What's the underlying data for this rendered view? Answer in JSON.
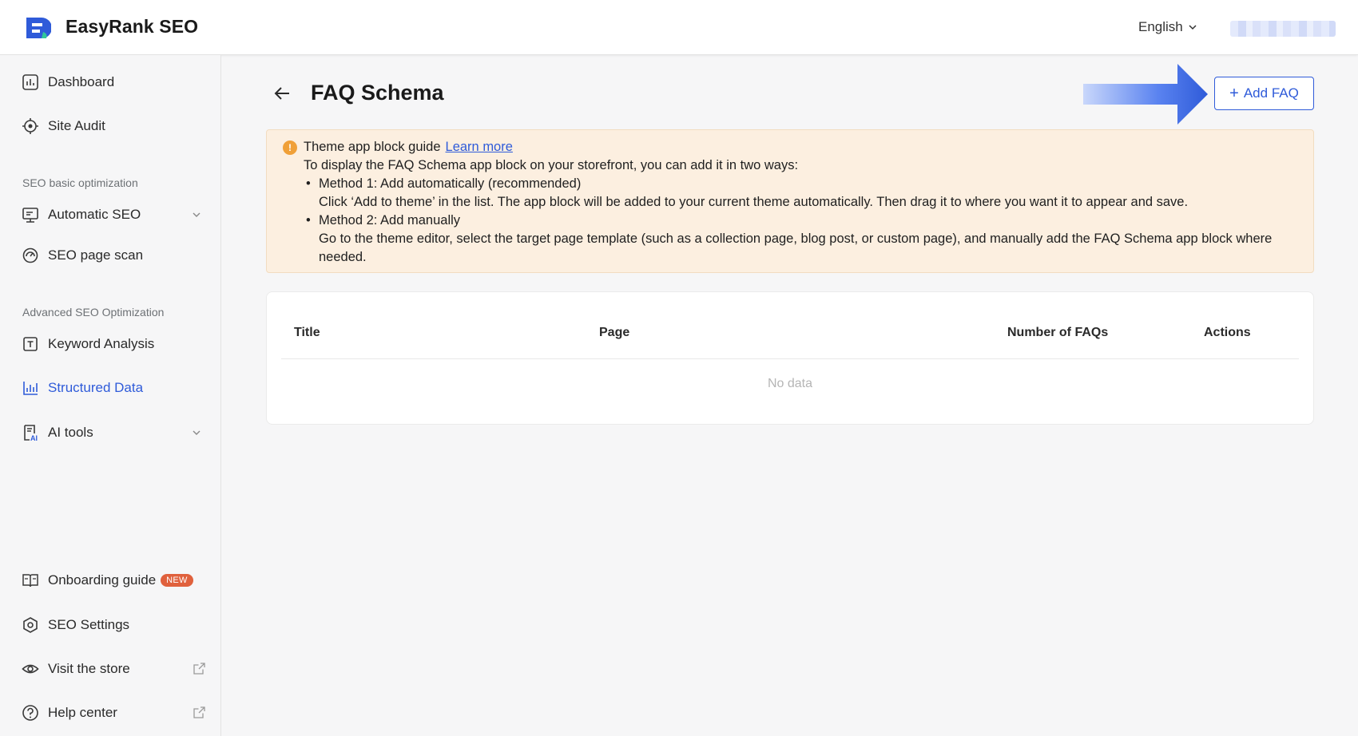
{
  "header": {
    "brand": "EasyRank SEO",
    "language": "English"
  },
  "sidebar": {
    "items_top": [
      {
        "label": "Dashboard",
        "icon": "dashboard-icon"
      },
      {
        "label": "Site Audit",
        "icon": "target-icon"
      }
    ],
    "section_basic": "SEO basic optimization",
    "items_basic": [
      {
        "label": "Automatic SEO",
        "icon": "monitor-icon"
      },
      {
        "label": "SEO page scan",
        "icon": "scan-icon"
      }
    ],
    "section_advanced": "Advanced SEO Optimization",
    "items_advanced": [
      {
        "label": "Keyword Analysis",
        "icon": "keyword-icon"
      },
      {
        "label": "Structured Data",
        "icon": "chart-icon",
        "active": true
      },
      {
        "label": "AI tools",
        "icon": "ai-doc-icon"
      }
    ],
    "items_bottom": [
      {
        "label": "Onboarding guide",
        "icon": "book-icon",
        "badge": "NEW"
      },
      {
        "label": "SEO Settings",
        "icon": "settings-hex-icon"
      },
      {
        "label": "Visit the store",
        "icon": "eye-icon"
      },
      {
        "label": "Help center",
        "icon": "help-icon"
      }
    ]
  },
  "main": {
    "title": "FAQ Schema",
    "add_button": "Add FAQ",
    "guide": {
      "title": "Theme app block guide",
      "link": "Learn more",
      "intro": "To display the FAQ Schema app block on your storefront, you can add it in two ways:",
      "method1_title": "Method 1: Add automatically (recommended)",
      "method1_text": "Click ‘Add to theme’ in the list. The app block will be added to your current theme automatically. Then drag it to where you want it to appear and save.",
      "method2_title": "Method 2: Add manually",
      "method2_text": "Go to the theme editor, select the target page template (such as a collection page, blog post, or custom page), and manually add the FAQ Schema app block where needed."
    },
    "table": {
      "columns": [
        "Title",
        "Page",
        "Number of FAQs",
        "Actions"
      ],
      "empty_text": "No data"
    }
  },
  "colors": {
    "accent": "#2f5bd9",
    "guide_bg": "#fcefe0",
    "badge": "#e0613d",
    "warning_icon": "#f0a038"
  }
}
